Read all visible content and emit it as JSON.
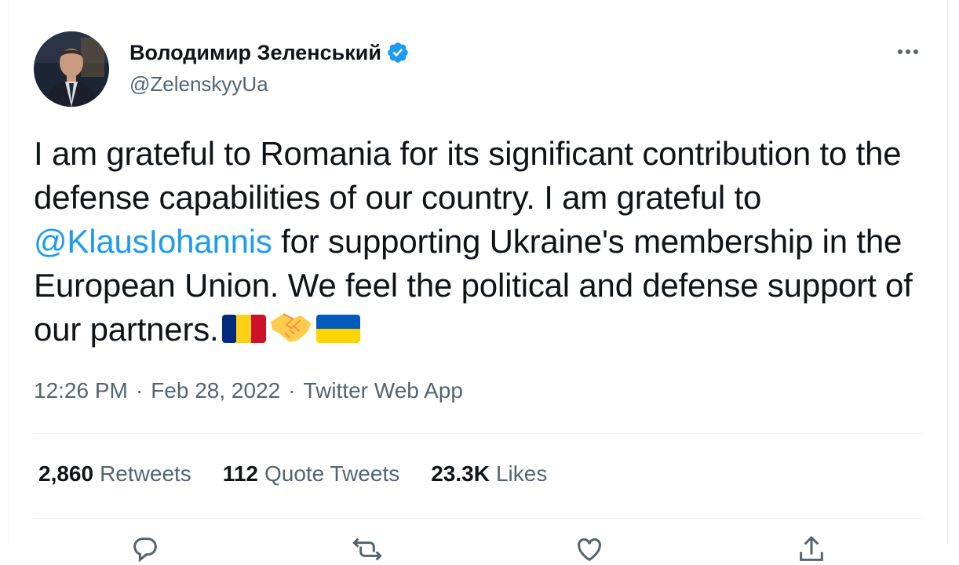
{
  "author": {
    "display_name": "Володимир Зеленський",
    "handle": "@ZelenskyyUa",
    "verified": true
  },
  "tweet": {
    "text_before_mention": "I am grateful to Romania for its significant contribution to the defense capabilities of our country. I am grateful to ",
    "mention": "@KlausIohannis",
    "text_after_mention": " for supporting Ukraine's membership in the European Union. We feel the political and defense support of our partners.",
    "emojis": [
      "romania-flag",
      "handshake",
      "ukraine-flag"
    ]
  },
  "meta": {
    "time": "12:26 PM",
    "separator": "·",
    "date": "Feb 28, 2022",
    "source": "Twitter Web App"
  },
  "stats": {
    "retweets_count": "2,860",
    "retweets_label": "Retweets",
    "quotes_count": "112",
    "quotes_label": "Quote Tweets",
    "likes_count": "23.3K",
    "likes_label": "Likes"
  },
  "colors": {
    "accent": "#1d9bf0",
    "secondary_text": "#536471",
    "primary_text": "#0f1419",
    "divider": "#eff3f4"
  }
}
